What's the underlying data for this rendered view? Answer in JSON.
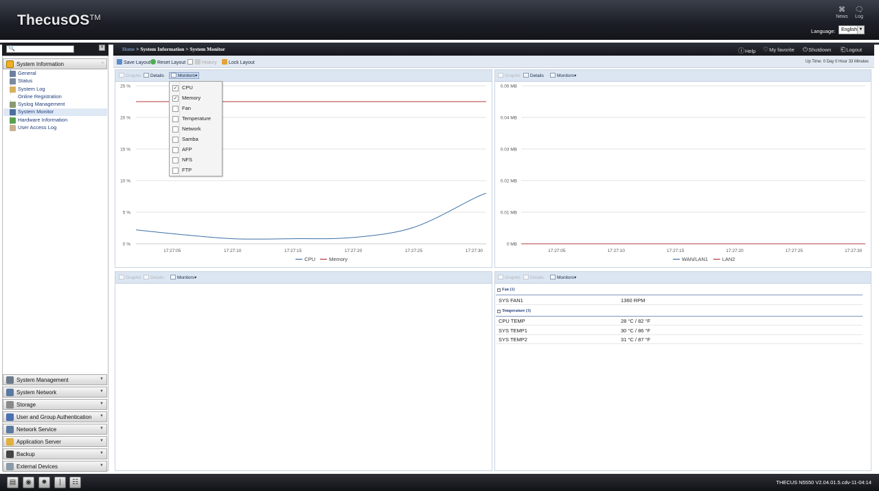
{
  "header": {
    "logo": "ThecusOS",
    "logo_tm": "TM",
    "news_label": "News",
    "log_label": "Log",
    "language_label": "Language:",
    "language_value": "English"
  },
  "sidebar": {
    "search_placeholder": "",
    "active_section": "System Information",
    "items": [
      {
        "label": "General",
        "icon": "general-icon"
      },
      {
        "label": "Status",
        "icon": "status-icon"
      },
      {
        "label": "System Log",
        "icon": "log-icon"
      },
      {
        "label": "Online Registration",
        "icon": "registration-icon"
      },
      {
        "label": "Syslog Management",
        "icon": "syslog-icon"
      },
      {
        "label": "System Monitor",
        "icon": "monitor-icon",
        "selected": true
      },
      {
        "label": "Hardware Information",
        "icon": "hardware-icon"
      },
      {
        "label": "User Access Log",
        "icon": "access-log-icon"
      }
    ],
    "sections": [
      "System Management",
      "System Network",
      "Storage",
      "User and Group Authentication",
      "Network Service",
      "Application Server",
      "Backup",
      "External Devices"
    ]
  },
  "breadcrumb": {
    "home": "Home",
    "sep": " > ",
    "level1": "System Information",
    "level2": "System Monitor"
  },
  "header_links": {
    "help": "Help",
    "favorite": "My favorite",
    "shutdown": "Shutdown",
    "logout": "Logout"
  },
  "toolbar": {
    "save_layout": "Save Layout",
    "reset_layout": "Reset Layout",
    "history": "History",
    "lock_layout": "Lock Layout",
    "uptime_label": "Up Time:",
    "uptime_value": "0 Day 0 Hour 33 Minutes"
  },
  "panel_buttons": {
    "graphic": "Graphic",
    "details": "Details",
    "monitors": "Monitors"
  },
  "monitors_menu": [
    {
      "label": "CPU",
      "checked": true
    },
    {
      "label": "Memory",
      "checked": true
    },
    {
      "label": "Fan",
      "checked": false
    },
    {
      "label": "Temperature",
      "checked": false
    },
    {
      "label": "Network",
      "checked": false
    },
    {
      "label": "Samba",
      "checked": false
    },
    {
      "label": "AFP",
      "checked": false
    },
    {
      "label": "NFS",
      "checked": false
    },
    {
      "label": "FTP",
      "checked": false
    }
  ],
  "chart_data": [
    {
      "type": "line",
      "x": [
        "17:27:02",
        "17:27:05",
        "17:27:10",
        "17:27:15",
        "17:27:20",
        "17:27:25",
        "17:27:30",
        "17:27:31"
      ],
      "x_ticks": [
        "17:27:05",
        "17:27:10",
        "17:27:15",
        "17:27:20",
        "17:27:25",
        "17:27:30"
      ],
      "y_ticks": [
        "25 %",
        "20 %",
        "15 %",
        "10 %",
        "5 %",
        "0 %"
      ],
      "ylim": [
        0,
        25
      ],
      "grid": true,
      "legend": "bottom-center",
      "series": [
        {
          "name": "CPU",
          "color": "#3b6ea5",
          "values": [
            2.2,
            1.6,
            0.8,
            0.8,
            1.0,
            2.6,
            7.2,
            8.0
          ]
        },
        {
          "name": "Memory",
          "color": "#b5373a",
          "values": [
            22.5,
            22.5,
            22.5,
            22.5,
            22.5,
            22.5,
            22.5,
            22.5
          ]
        }
      ]
    },
    {
      "type": "line",
      "x": [
        "17:27:02",
        "17:27:05",
        "17:27:10",
        "17:27:15",
        "17:27:20",
        "17:27:25",
        "17:27:30",
        "17:27:31"
      ],
      "x_ticks": [
        "17:27:05",
        "17:27:10",
        "17:27:15",
        "17:27:20",
        "17:27:25",
        "17:27:30"
      ],
      "y_ticks": [
        "0.05 MB",
        "0.04 MB",
        "0.03 MB",
        "0.02 MB",
        "0.01 MB",
        "0 MB"
      ],
      "ylim": [
        0,
        0.05
      ],
      "grid": true,
      "legend": "bottom-center",
      "series": [
        {
          "name": "WAN/LAN1",
          "color": "#3b6ea5",
          "values": [
            0,
            0,
            0,
            0,
            0,
            0,
            0,
            0
          ]
        },
        {
          "name": "LAN2",
          "color": "#b5373a",
          "values": [
            0,
            0,
            0,
            0,
            0,
            0,
            0,
            0
          ]
        }
      ]
    }
  ],
  "details": {
    "fan_header": "Fan (1)",
    "fan_rows": [
      {
        "name": "SYS FAN1",
        "value": "1360 RPM"
      }
    ],
    "temp_header": "Temperature (3)",
    "temp_rows": [
      {
        "name": "CPU TEMP",
        "value": "28 °C / 82 °F"
      },
      {
        "name": "SYS TEMP1",
        "value": "30 °C / 86 °F"
      },
      {
        "name": "SYS TEMP2",
        "value": "31 °C / 87 °F"
      }
    ]
  },
  "footer": {
    "version": "THECUS N5550 V2.04.01.5.cdv-11-04:14"
  }
}
